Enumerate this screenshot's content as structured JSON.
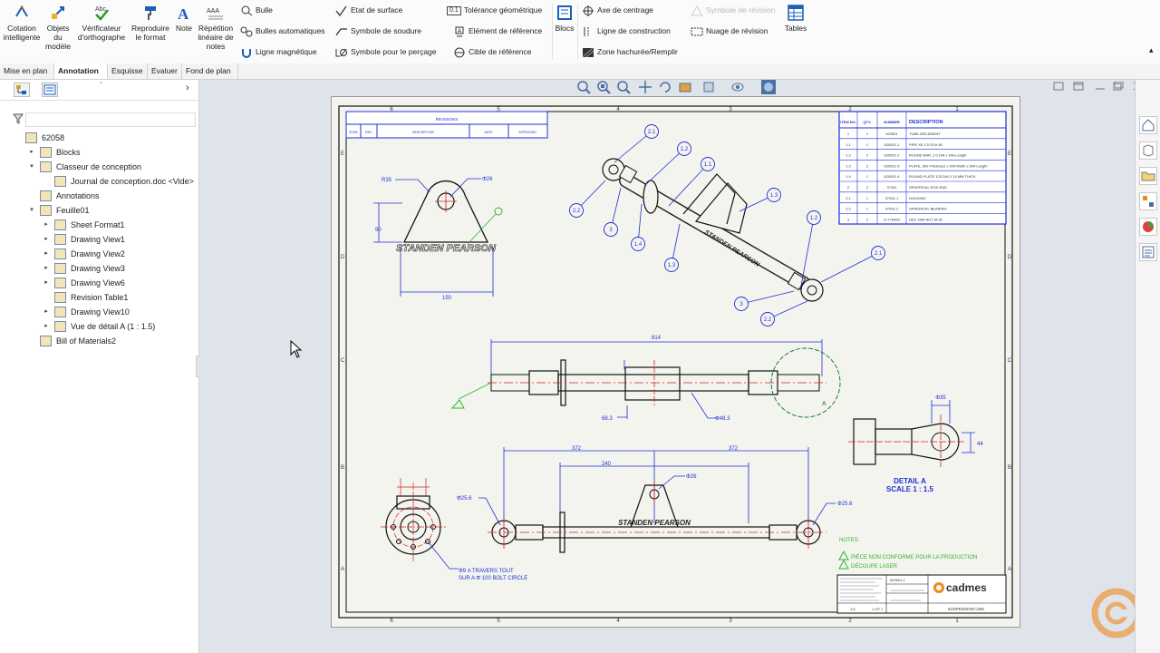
{
  "ribbon": {
    "big_buttons": [
      {
        "label": "Cotation intelligente",
        "icon": "smart-dimension-icon"
      },
      {
        "label": "Objets du modèle",
        "icon": "model-items-icon"
      },
      {
        "label": "Vérificateur d'orthographe",
        "icon": "spell-check-icon"
      },
      {
        "label": "Reproduire le format",
        "icon": "format-painter-icon"
      },
      {
        "label": "Note",
        "icon": "note-icon"
      },
      {
        "label": "Répétition linéaire de notes",
        "icon": "linear-note-pattern-icon"
      }
    ],
    "col1": [
      "Bulle",
      "Bulles automatiques",
      "Ligne magnétique"
    ],
    "col2": [
      "Etat de surface",
      "Symbole de soudure",
      "Symbole pour le perçage"
    ],
    "col3": [
      "Tolérance géométrique",
      "Elément de référence",
      "Cible de référence"
    ],
    "tol_badge": "0.1",
    "blocs": "Blocs",
    "col4": [
      "Axe de centrage",
      "Ligne de construction",
      "Zone hachurée/Remplir"
    ],
    "col5": [
      "Symbole de révision",
      "Nuage de révision"
    ],
    "tables": "Tables"
  },
  "tabs": [
    {
      "label": "Mise en plan",
      "active": false
    },
    {
      "label": "Annotation",
      "active": true
    },
    {
      "label": "Esquisse",
      "active": false
    },
    {
      "label": "Evaluer",
      "active": false
    },
    {
      "label": "Fond de plan",
      "active": false
    }
  ],
  "tree": [
    {
      "label": "62058",
      "level": 0,
      "arrow": ""
    },
    {
      "label": "Blocks",
      "level": 1,
      "arrow": "▸"
    },
    {
      "label": "Classeur de conception",
      "level": 1,
      "arrow": "▾"
    },
    {
      "label": "Journal de conception.doc <Vide>",
      "level": 2,
      "arrow": ""
    },
    {
      "label": "Annotations",
      "level": 1,
      "arrow": ""
    },
    {
      "label": "Feuille01",
      "level": 1,
      "arrow": "▾"
    },
    {
      "label": "Sheet Format1",
      "level": 2,
      "arrow": "▸"
    },
    {
      "label": "Drawing View1",
      "level": 2,
      "arrow": "▸"
    },
    {
      "label": "Drawing View2",
      "level": 2,
      "arrow": "▸"
    },
    {
      "label": "Drawing View3",
      "level": 2,
      "arrow": "▸"
    },
    {
      "label": "Drawing View6",
      "level": 2,
      "arrow": "▸"
    },
    {
      "label": "Revision Table1",
      "level": 2,
      "arrow": ""
    },
    {
      "label": "Drawing View10",
      "level": 2,
      "arrow": "▸"
    },
    {
      "label": "Vue de détail A (1 : 1.5)",
      "level": 2,
      "arrow": "▸"
    },
    {
      "label": "Bill of Materials2",
      "level": 1,
      "arrow": ""
    }
  ],
  "drawing": {
    "zones_top": [
      "6",
      "5",
      "4",
      "3",
      "2",
      "1"
    ],
    "zones_side": [
      "E",
      "D",
      "C",
      "B",
      "A"
    ],
    "revision_title": "REVISIONS",
    "revision_headers": [
      "ZONE",
      "REV.",
      "DESCRIPTION",
      "DATE",
      "APPROVED"
    ],
    "bom_headers": [
      "ITEM NO.",
      "QTY.",
      "NUMBER",
      "DESCRIPTION"
    ],
    "bom_rows": [
      [
        "1",
        "1",
        "620501",
        "TUBE-WELDMENT"
      ],
      [
        "1.1",
        "1",
        "620501-1",
        "PIPE X5 1.5 SCH 80"
      ],
      [
        "1.2",
        "2",
        "620501-2",
        "ROUND BAR, 2.0 DIA x SW-Length"
      ],
      [
        "1.3",
        "2",
        "620501-3",
        "PLATE, SW-Thickness x SW-Width x SW-Length"
      ],
      [
        "1.4",
        "1",
        "620501-4",
        "ROUND PLATE 125 DIA X 10 MM THICK"
      ],
      [
        "2",
        "2",
        "37261",
        "SPHERICAL ROD END"
      ],
      [
        "2.1",
        "1",
        "37261-1",
        "HOUSING"
      ],
      [
        "2.2",
        "1",
        "37261-2",
        "SPHERICAL BEARING"
      ],
      [
        "3",
        "2",
        "H-778963",
        "HEX JAM NUT M-36"
      ]
    ],
    "dims": {
      "r35": "R35",
      "d26": "Φ26",
      "h90": "90",
      "w150": "150",
      "len814": "814",
      "d68": "68.3",
      "d48": "Φ48.3",
      "l372a": "372",
      "l372b": "372",
      "l240": "240",
      "d26b": "Φ26",
      "d256a": "Φ25.6",
      "d256b": "Φ25.6",
      "d35": "Φ35",
      "h44": "44",
      "detail_letter": "A"
    },
    "balloons": [
      "2.1",
      "1.2",
      "1.1",
      "2.2",
      "3",
      "1.4",
      "1.3",
      "1.3",
      "1.2",
      "2.1",
      "3",
      "2.2"
    ],
    "brand_logo": "STANDEN PEARSON",
    "detail_title": "DETAIL A",
    "detail_scale": "SCALE 1 : 1.5",
    "hole_note_1": "Φ9 A TRAVERS TOUT",
    "hole_note_2": "SUR A  Φ 100 BOLT CIRCLE",
    "notes_title": "NOTES:",
    "note_1": "PIÈCE NON CONFORME POUR LA PRODUCTION",
    "note_2": "DÉCOUPE LASER",
    "note_tag": "A",
    "tb_part_no": "620501-1",
    "tb_title": "SUSPENSION LINK",
    "tb_scale": "1:5",
    "tb_sheet": "1 OF 1",
    "tb_logo": "cadmes"
  },
  "colors": {
    "annotation_blue": "#1f2fd6",
    "center_red": "#d42020",
    "note_green": "#2db52d",
    "cadmes_orange": "#f08a1c"
  }
}
